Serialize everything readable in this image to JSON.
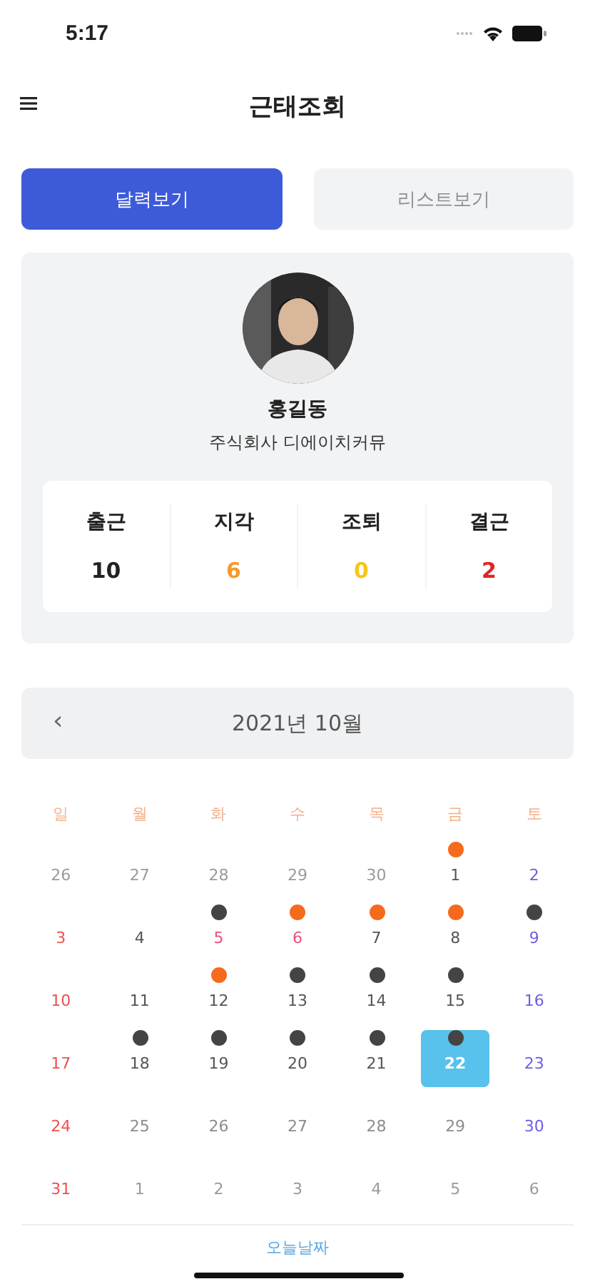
{
  "status_bar": {
    "time": "5:17"
  },
  "header": {
    "title": "근태조회"
  },
  "tabs": [
    {
      "label": "달력보기",
      "selected": true
    },
    {
      "label": "리스트보기",
      "selected": false
    }
  ],
  "profile": {
    "name": "홍길동",
    "company": "주식회사 디에이치커뮤"
  },
  "stats": [
    {
      "label": "출근",
      "value": "10",
      "color": "#222222"
    },
    {
      "label": "지각",
      "value": "6",
      "color": "#f39a2c"
    },
    {
      "label": "조퇴",
      "value": "0",
      "color": "#f5c518"
    },
    {
      "label": "결근",
      "value": "2",
      "color": "#e02424"
    }
  ],
  "calendar": {
    "prev": "‹",
    "month": "2021년 10월",
    "weekdays": [
      "일",
      "월",
      "화",
      "수",
      "목",
      "금",
      "토"
    ],
    "days": [
      {
        "text": "26",
        "kind": "outside",
        "selected": false
      },
      {
        "text": "27",
        "kind": "outside",
        "selected": false
      },
      {
        "text": "28",
        "kind": "outside",
        "selected": false
      },
      {
        "text": "29",
        "kind": "outside",
        "selected": false
      },
      {
        "text": "30",
        "kind": "outside",
        "selected": false
      },
      {
        "text": "1",
        "kind": "normal",
        "selected": false,
        "color": "#f56a1c"
      },
      {
        "text": "2",
        "kind": "saturday",
        "selected": false
      },
      {
        "text": "3",
        "kind": "sunday",
        "selected": false
      },
      {
        "text": "4",
        "kind": "normal",
        "selected": false
      },
      {
        "text": "5",
        "kind": "holiday",
        "selected": false,
        "color": "#444444"
      },
      {
        "text": "6",
        "kind": "holiday",
        "selected": false,
        "color": "#f56a1c"
      },
      {
        "text": "7",
        "kind": "normal",
        "selected": false,
        "color": "#f56a1c"
      },
      {
        "text": "8",
        "kind": "normal",
        "selected": false,
        "color": "#f56a1c"
      },
      {
        "text": "9",
        "kind": "saturday",
        "selected": false,
        "color": "#444444"
      },
      {
        "text": "10",
        "kind": "sunday",
        "selected": false
      },
      {
        "text": "11",
        "kind": "normal",
        "selected": false
      },
      {
        "text": "12",
        "kind": "normal",
        "selected": false,
        "color": "#f56a1c"
      },
      {
        "text": "13",
        "kind": "normal",
        "selected": false,
        "color": "#444444"
      },
      {
        "text": "14",
        "kind": "normal",
        "selected": false,
        "color": "#444444"
      },
      {
        "text": "15",
        "kind": "normal",
        "selected": false,
        "color": "#444444"
      },
      {
        "text": "16",
        "kind": "saturday",
        "selected": false
      },
      {
        "text": "17",
        "kind": "sunday",
        "selected": false
      },
      {
        "text": "18",
        "kind": "normal",
        "selected": false,
        "color": "#444444"
      },
      {
        "text": "19",
        "kind": "normal",
        "selected": false,
        "color": "#444444"
      },
      {
        "text": "20",
        "kind": "normal",
        "selected": false,
        "color": "#444444"
      },
      {
        "text": "21",
        "kind": "normal",
        "selected": false,
        "color": "#444444"
      },
      {
        "text": "22",
        "kind": "normal",
        "selected": true,
        "color": "#444444"
      },
      {
        "text": "23",
        "kind": "saturday",
        "selected": false
      },
      {
        "text": "24",
        "kind": "sunday",
        "selected": false
      },
      {
        "text": "25",
        "kind": "future",
        "selected": false
      },
      {
        "text": "26",
        "kind": "future",
        "selected": false
      },
      {
        "text": "27",
        "kind": "future",
        "selected": false
      },
      {
        "text": "28",
        "kind": "future",
        "selected": false
      },
      {
        "text": "29",
        "kind": "future",
        "selected": false
      },
      {
        "text": "30",
        "kind": "saturday",
        "selected": false
      },
      {
        "text": "31",
        "kind": "sunday",
        "selected": false
      },
      {
        "text": "1",
        "kind": "outside",
        "selected": false
      },
      {
        "text": "2",
        "kind": "outside",
        "selected": false
      },
      {
        "text": "3",
        "kind": "outside",
        "selected": false
      },
      {
        "text": "4",
        "kind": "outside",
        "selected": false
      },
      {
        "text": "5",
        "kind": "outside",
        "selected": false
      },
      {
        "text": "6",
        "kind": "outside",
        "selected": false
      }
    ],
    "today_link": "오늘날짜"
  }
}
